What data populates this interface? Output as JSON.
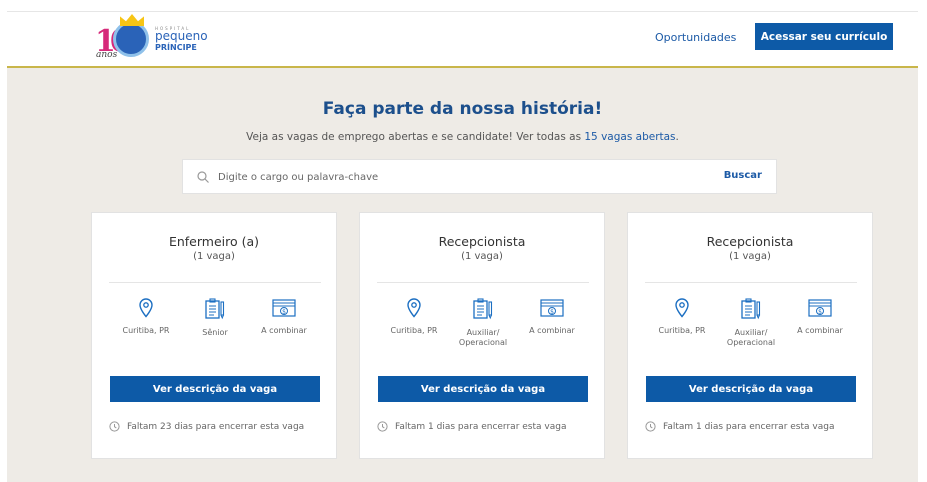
{
  "header": {
    "logo": {
      "badge_text": "10",
      "anos": "anos",
      "hospital": "HOSPITAL",
      "pequeno": "pequeno",
      "principe": "PRÍNCIPE"
    },
    "nav_link": "Oportunidades",
    "cta_label": "Acessar seu currículo"
  },
  "hero": {
    "title": "Faça parte da nossa história!",
    "subtitle_prefix": "Veja as vagas de emprego abertas e se candidate! Ver todas as ",
    "subtitle_link": "15 vagas abertas",
    "subtitle_suffix": "."
  },
  "search": {
    "placeholder": "Digite o cargo ou palavra-chave",
    "value": "",
    "button_label": "Buscar"
  },
  "jobs": [
    {
      "title": "Enfermeiro (a)",
      "count": "(1 vaga)",
      "location": "Curitiba, PR",
      "level": "Sênior",
      "salary": "A combinar",
      "button": "Ver descrição da vaga",
      "deadline": "Faltam 23 dias para encerrar esta vaga"
    },
    {
      "title": "Recepcionista",
      "count": "(1 vaga)",
      "location": "Curitiba, PR",
      "level": "Auxiliar/ Operacional",
      "salary": "A combinar",
      "button": "Ver descrição da vaga",
      "deadline": "Faltam 1 dias para encerrar esta vaga"
    },
    {
      "title": "Recepcionista",
      "count": "(1 vaga)",
      "location": "Curitiba, PR",
      "level": "Auxiliar/ Operacional",
      "salary": "A combinar",
      "button": "Ver descrição da vaga",
      "deadline": "Faltam 1 dias para encerrar esta vaga"
    }
  ],
  "colors": {
    "primary": "#0d5aa7",
    "link": "#1c5aa6",
    "background": "#eeebe6",
    "header_accent": "#c9b64a"
  },
  "icons": [
    "search-icon",
    "location-pin-icon",
    "clipboard-icon",
    "money-icon",
    "clock-icon"
  ]
}
